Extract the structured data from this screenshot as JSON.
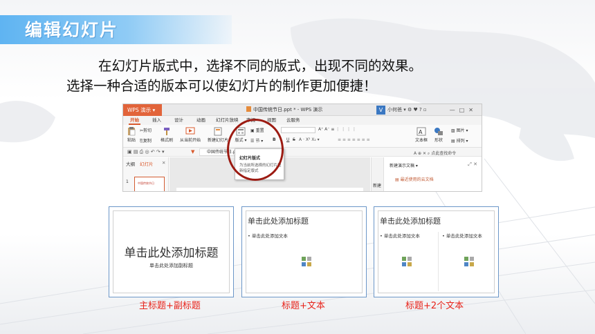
{
  "slide": {
    "heading": "编辑幻灯片",
    "paragraph_line1": "在幻灯片版式中，选择不同的版式，出现不同的效果。",
    "paragraph_line2": "选择一种合适的版本可以使幻灯片的制作更加便捷！"
  },
  "wps": {
    "app_button": "WPS 演示",
    "doc_title": "中国传统节日.ppt * - WPS 演示",
    "user_name": "小何爸",
    "tabs": [
      "开始",
      "插入",
      "设计",
      "动画",
      "幻灯片放映",
      "审阅",
      "视图",
      "云服务"
    ],
    "active_tab": "开始",
    "ribbon": {
      "paste": "粘贴",
      "cut": "剪切",
      "copy": "复制",
      "format_painter": "格式刷",
      "from_current": "从当前开始",
      "new_slide": "新建幻灯片",
      "layout": "版式",
      "reset": "重置",
      "section": "节",
      "bold": "B",
      "italic": "I",
      "underline": "U",
      "strike": "S",
      "textbox": "文本框",
      "shape": "形状",
      "arrange": "排列",
      "picture": "图片",
      "find_cmd": "点此查找命令"
    },
    "file_tab": "中国传统节日.p...",
    "side_tabs": [
      "大纲",
      "幻灯片"
    ],
    "slide_number": "1",
    "thumb_text": "中国传统节日",
    "tooltip": {
      "title": "幻灯片版式",
      "desc": "为当前所选择的幻灯片重新指定版式"
    },
    "task_pane": {
      "title": "新建演示文稿",
      "link": "最近使用的云文档",
      "new_label": "新建"
    }
  },
  "layouts": [
    {
      "name": "title-subtitle",
      "title": "单击此处添加标题",
      "subtitle": "单击此处添加副标题",
      "caption": "主标题+副标题"
    },
    {
      "name": "title-text",
      "title": "单击此处添加标题",
      "bullet": "• 单击此处添加文本",
      "caption": "标题+文本"
    },
    {
      "name": "title-two-text",
      "title": "单击此处添加标题",
      "bullet_left": "• 单击此处添加文本",
      "bullet_right": "• 单击此处添加文本",
      "caption": "标题+2个文本"
    }
  ],
  "colors": {
    "heading_band": "#5fb4f2",
    "caption_red": "#e8231a",
    "highlight_circle": "#9c1b12",
    "wps_accent": "#d9582b"
  }
}
